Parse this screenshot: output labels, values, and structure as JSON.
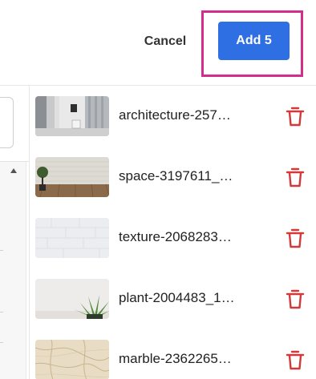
{
  "header": {
    "cancel_label": "Cancel",
    "add_label": "Add 5"
  },
  "colors": {
    "accent": "#2f6fe4",
    "highlight": "#d42e8c",
    "delete": "#d23a3a"
  },
  "files": [
    {
      "name": "architecture-257…",
      "thumb": "architecture"
    },
    {
      "name": "space-3197611_…",
      "thumb": "space"
    },
    {
      "name": "texture-2068283…",
      "thumb": "texture"
    },
    {
      "name": "plant-2004483_1…",
      "thumb": "plant"
    },
    {
      "name": "marble-2362265…",
      "thumb": "marble"
    }
  ],
  "icons": {
    "delete": "trash-icon",
    "scroll_up": "scroll-up-icon"
  }
}
